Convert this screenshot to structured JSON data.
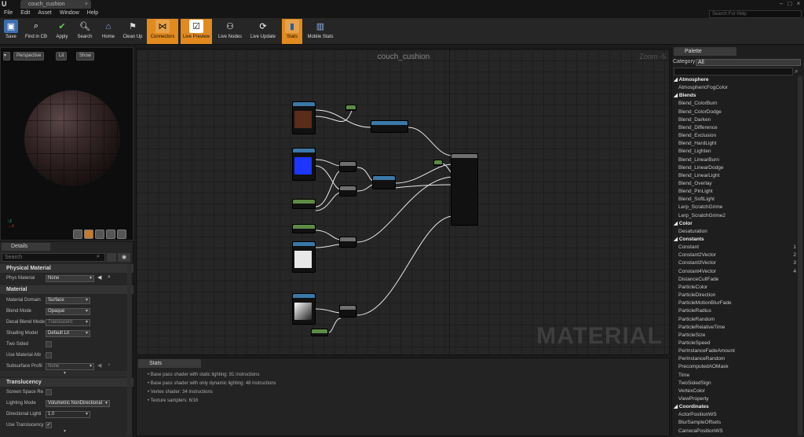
{
  "window": {
    "tab_title": "couch_cushion",
    "search_help_placeholder": "Search For Help"
  },
  "menu": [
    "File",
    "Edit",
    "Asset",
    "Window",
    "Help"
  ],
  "toolbar": [
    {
      "label": "Save",
      "icon": "save-icon",
      "active": false
    },
    {
      "label": "Find in CB",
      "icon": "find-in-cb-icon",
      "active": false
    },
    {
      "label": "Apply",
      "icon": "apply-icon",
      "active": false
    },
    {
      "label": "Search",
      "icon": "search-icon",
      "active": false
    },
    {
      "label": "Home",
      "icon": "home-icon",
      "active": false
    },
    {
      "label": "Clean Up",
      "icon": "clean-up-icon",
      "active": false
    },
    {
      "label": "Connectors",
      "icon": "connectors-icon",
      "active": true
    },
    {
      "label": "Live Preview",
      "icon": "live-preview-icon",
      "active": true
    },
    {
      "label": "Live Nodes",
      "icon": "live-nodes-icon",
      "active": false
    },
    {
      "label": "Live Update",
      "icon": "live-update-icon",
      "active": false
    },
    {
      "label": "Stats",
      "icon": "stats-icon",
      "active": true
    },
    {
      "label": "Mobile Stats",
      "icon": "mobile-stats-icon",
      "active": false
    }
  ],
  "viewport": {
    "perspective": "Perspective",
    "lit": "Lit",
    "show": "Show"
  },
  "details": {
    "tab": "Details",
    "search_placeholder": "Search",
    "sections": {
      "physical": "Physical Material",
      "material": "Material",
      "translucency": "Translucency"
    },
    "props": {
      "phys_material": {
        "label": "Phys Material",
        "value": "None"
      },
      "material_domain": {
        "label": "Material Domain",
        "value": "Surface"
      },
      "blend_mode": {
        "label": "Blend Mode",
        "value": "Opaque"
      },
      "decal_blend_mode": {
        "label": "Decal Blend Mode",
        "value": "Translucent"
      },
      "shading_model": {
        "label": "Shading Model",
        "value": "Default Lit"
      },
      "two_sided": {
        "label": "Two Sided"
      },
      "use_material_attr": {
        "label": "Use Material Attr"
      },
      "subsurface_profile": {
        "label": "Subsurface Profil",
        "value": "None"
      },
      "screen_space_re": {
        "label": "Screen Space Re"
      },
      "lighting_mode": {
        "label": "Lighting Mode",
        "value": "Volumetric NonDirectional"
      },
      "directional_light": {
        "label": "Directional Lighti",
        "value": "1.0"
      },
      "use_translucency": {
        "label": "Use Translucency"
      }
    }
  },
  "graph": {
    "title": "couch_cushion",
    "zoom": "Zoom -5",
    "watermark": "MATERIAL"
  },
  "stats": {
    "tab": "Stats",
    "lines": [
      "Base pass shader with static lighting: 81 instructions",
      "Base pass shader with only dynamic lighting: 48 instructions",
      "Vertex shader: 34 instructions",
      "Texture samplers: 6/16"
    ]
  },
  "palette": {
    "tab": "Palette",
    "category_label": "Category:",
    "category_value": "All",
    "items": [
      {
        "text": "Atmosphere",
        "cat": true
      },
      {
        "text": "AtmosphericFogColor"
      },
      {
        "text": "Blends",
        "cat": true
      },
      {
        "text": "Blend_ColorBurn"
      },
      {
        "text": "Blend_ColorDodge"
      },
      {
        "text": "Blend_Darken"
      },
      {
        "text": "Blend_Difference"
      },
      {
        "text": "Blend_Exclusion"
      },
      {
        "text": "Blend_HardLight"
      },
      {
        "text": "Blend_Lighten"
      },
      {
        "text": "Blend_LinearBurn"
      },
      {
        "text": "Blend_LinearDodge"
      },
      {
        "text": "Blend_LinearLight"
      },
      {
        "text": "Blend_Overlay"
      },
      {
        "text": "Blend_PinLight"
      },
      {
        "text": "Blend_SoftLight"
      },
      {
        "text": "Lerp_ScratchGrime"
      },
      {
        "text": "Lerp_ScratchGrime2"
      },
      {
        "text": "Color",
        "cat": true
      },
      {
        "text": "Desaturation"
      },
      {
        "text": "Constants",
        "cat": true
      },
      {
        "text": "Constant",
        "key": "1"
      },
      {
        "text": "Constant2Vector",
        "key": "2"
      },
      {
        "text": "Constant3Vector",
        "key": "3"
      },
      {
        "text": "Constant4Vector",
        "key": "4"
      },
      {
        "text": "DistanceCullFade"
      },
      {
        "text": "ParticleColor"
      },
      {
        "text": "ParticleDirection"
      },
      {
        "text": "ParticleMotionBlurFade"
      },
      {
        "text": "ParticleRadius"
      },
      {
        "text": "ParticleRandom"
      },
      {
        "text": "ParticleRelativeTime"
      },
      {
        "text": "ParticleSize"
      },
      {
        "text": "ParticleSpeed"
      },
      {
        "text": "PerInstanceFadeAmount"
      },
      {
        "text": "PerInstanceRandom"
      },
      {
        "text": "PrecomputedAOMask"
      },
      {
        "text": "Time"
      },
      {
        "text": "TwoSidedSign"
      },
      {
        "text": "VertexColor"
      },
      {
        "text": "ViewProperty"
      },
      {
        "text": "Coordinates",
        "cat": true
      },
      {
        "text": "ActorPositionWS"
      },
      {
        "text": "BlurSampleOffsets"
      },
      {
        "text": "CameraPositionWS"
      }
    ]
  },
  "colors": {
    "accent": "#e08a1f",
    "node_header_texture": "#3a78a8",
    "node_header_param": "#5d8a46"
  }
}
